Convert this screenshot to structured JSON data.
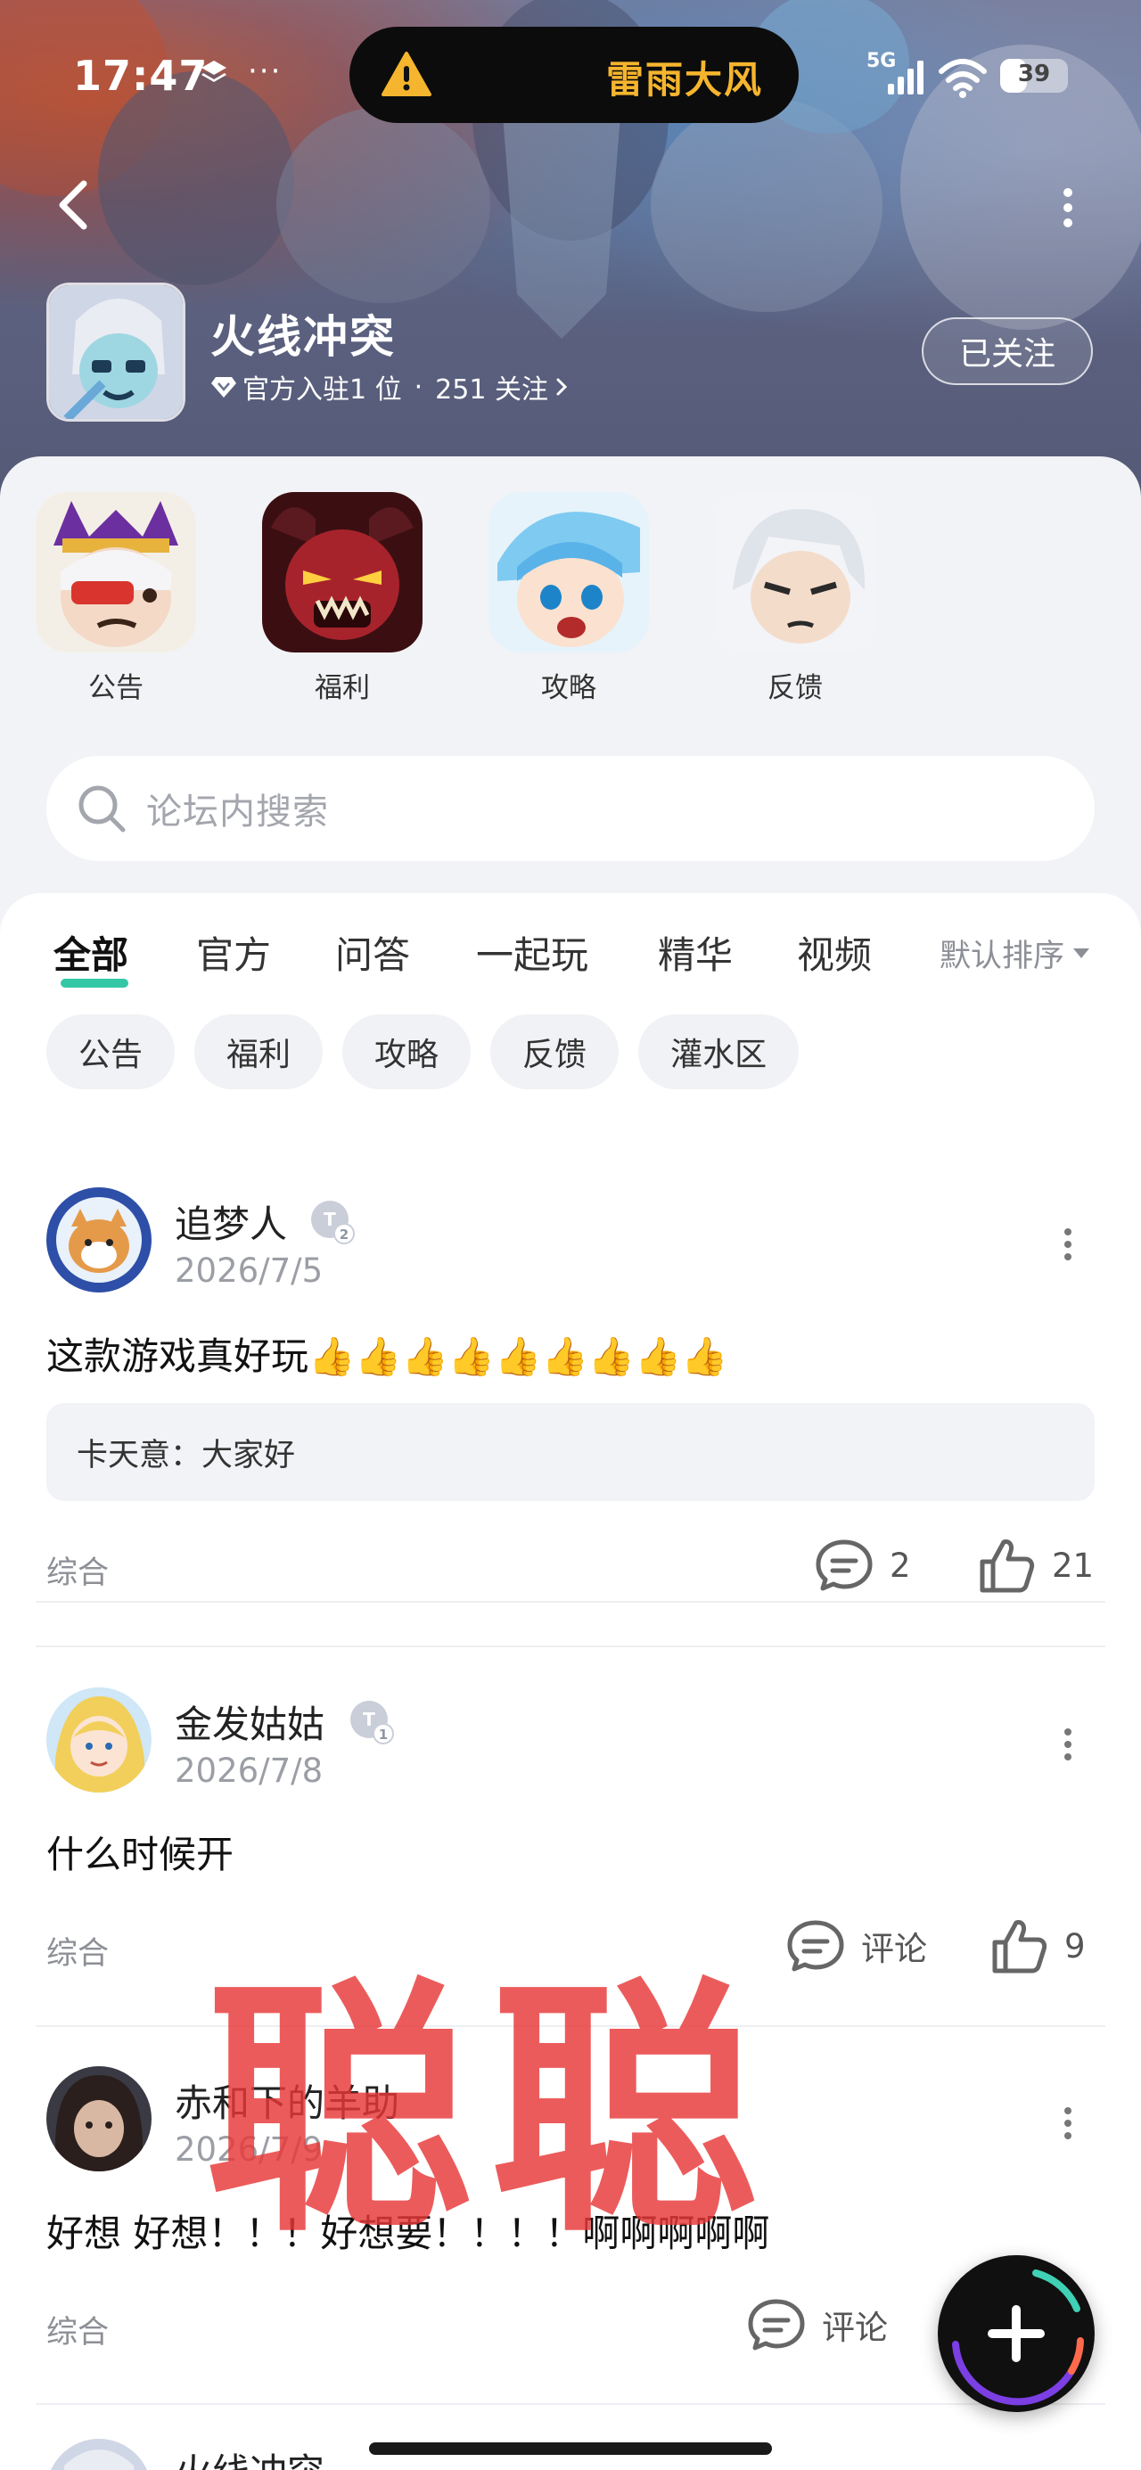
{
  "status_bar": {
    "time": "17:47",
    "network": "5G",
    "battery": "39",
    "battery_fraction": 0.39,
    "alert": "雷雨大风"
  },
  "game": {
    "name": "火线冲突",
    "meta_prefix": "官方入驻1 位",
    "meta_sep": "·",
    "followers": "251 关注",
    "follow_button": "已关注"
  },
  "shortcuts": [
    {
      "label": "公告",
      "icon": "announcement-hero-avatar"
    },
    {
      "label": "福利",
      "icon": "benefits-demon-avatar"
    },
    {
      "label": "攻略",
      "icon": "guide-mage-avatar"
    },
    {
      "label": "反馈",
      "icon": "feedback-knight-avatar"
    }
  ],
  "search": {
    "placeholder": "论坛内搜索"
  },
  "tabs": [
    {
      "label": "全部",
      "active": true
    },
    {
      "label": "官方",
      "active": false
    },
    {
      "label": "问答",
      "active": false
    },
    {
      "label": "一起玩",
      "active": false
    },
    {
      "label": "精华",
      "active": false
    },
    {
      "label": "视频",
      "active": false
    }
  ],
  "sort": {
    "label": "默认排序"
  },
  "chips": [
    "公告",
    "福利",
    "攻略",
    "反馈",
    "灌水区"
  ],
  "posts": [
    {
      "author": "追梦人",
      "level": "2",
      "date": "2026/7/5",
      "text": "这款游戏真好玩👍👍👍👍👍👍👍👍👍",
      "quote": "卡天意：大家好",
      "tag": "综合",
      "comments": "2",
      "likes": "21"
    },
    {
      "author": "金发姑姑",
      "level": "1",
      "date": "2026/7/8",
      "text": "什么时候开",
      "tag": "综合",
      "comments": "评论",
      "likes": "9"
    },
    {
      "author": "赤和下的羊助",
      "date": "2026/7/9",
      "text": "好想 好想！！！好想要！！！！啊啊啊啊啊",
      "tag": "综合",
      "comments": "评论"
    },
    {
      "author": "火线冲突"
    }
  ],
  "watermark": "聪聪",
  "colors": {
    "accent": "#34c7a6",
    "alert": "#f6b52e",
    "watermark": "#e83737"
  }
}
